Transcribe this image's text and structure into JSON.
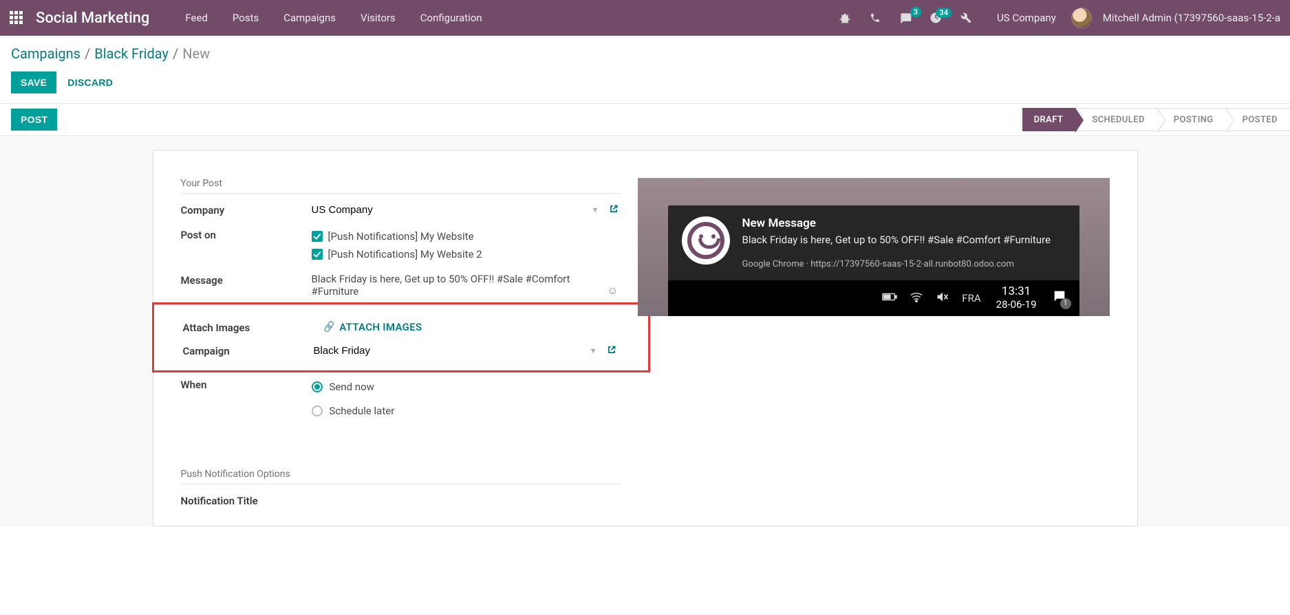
{
  "nav": {
    "brand": "Social Marketing",
    "items": [
      "Feed",
      "Posts",
      "Campaigns",
      "Visitors",
      "Configuration"
    ],
    "company": "US Company",
    "user": "Mitchell Admin (17397560-saas-15-2-a",
    "msg_badge": "3",
    "activity_badge": "34"
  },
  "breadcrumb": {
    "a": "Campaigns",
    "b": "Black Friday",
    "c": "New"
  },
  "actions": {
    "save": "SAVE",
    "discard": "DISCARD",
    "post": "POST"
  },
  "states": [
    "DRAFT",
    "SCHEDULED",
    "POSTING",
    "POSTED"
  ],
  "form": {
    "section1": "Your Post",
    "company_label": "Company",
    "company_value": "US Company",
    "post_on_label": "Post on",
    "post_on": [
      "[Push Notifications] My Website",
      "[Push Notifications] My Website 2"
    ],
    "message_label": "Message",
    "message_value": "Black Friday is here, Get up to 50% OFF!! #Sale #Comfort #Furniture",
    "attach_label": "Attach Images",
    "attach_btn": "ATTACH IMAGES",
    "campaign_label": "Campaign",
    "campaign_value": "Black Friday",
    "when_label": "When",
    "when_now": "Send now",
    "when_later": "Schedule later",
    "section2": "Push Notification Options",
    "notif_title_label": "Notification Title"
  },
  "preview": {
    "title": "New Message",
    "body": "Black Friday is here, Get up to 50% OFF!! #Sale #Comfort #Furniture",
    "source": "Google Chrome · https://17397560-saas-15-2-all.runbot80.odoo.com",
    "tray_lang": "FRA",
    "tray_time": "13:31",
    "tray_date": "28-06-19"
  }
}
